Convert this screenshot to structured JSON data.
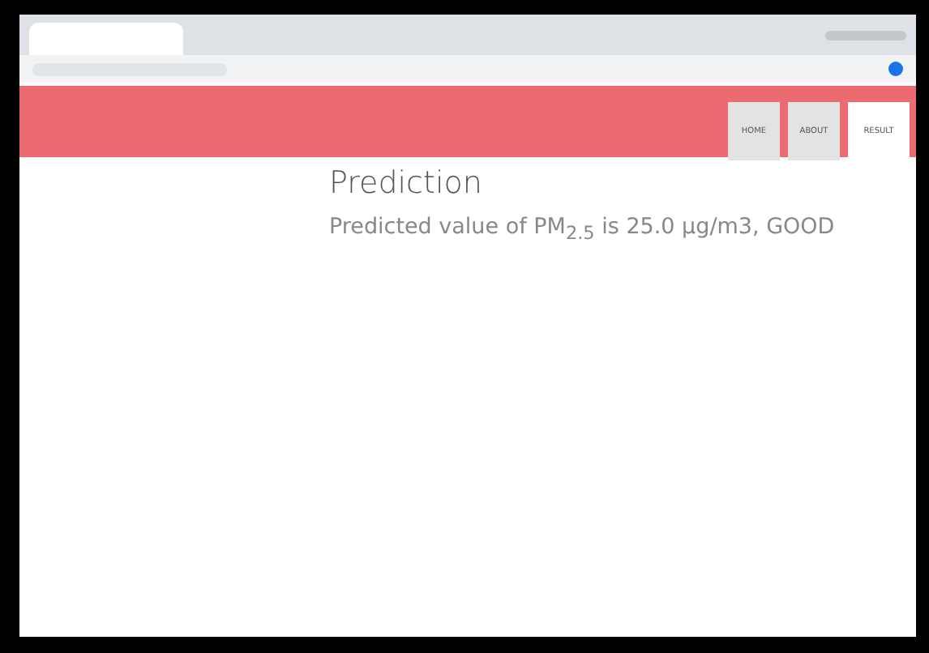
{
  "nav": {
    "tabs": [
      {
        "label": "HOME",
        "selected": false
      },
      {
        "label": "ABOUT",
        "selected": false
      },
      {
        "label": "RESULT",
        "selected": true
      }
    ]
  },
  "content": {
    "title": "Prediction",
    "text": "Predicted value of PM$_{2.5}$ is 25.0 μg/m3, GOOD"
  }
}
